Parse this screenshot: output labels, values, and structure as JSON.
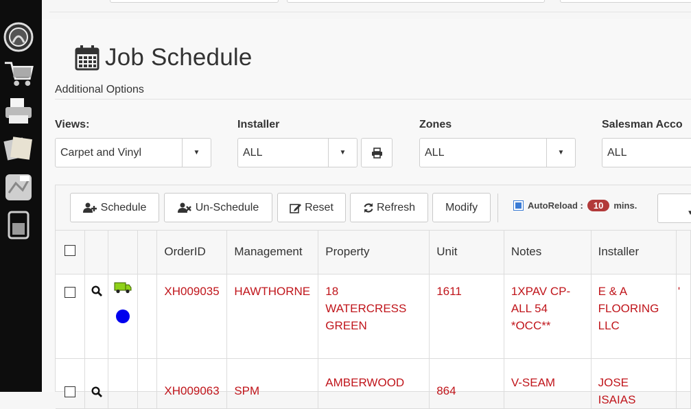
{
  "dock": {
    "items": [
      {
        "name": "dashboard-icon"
      },
      {
        "name": "cart-icon"
      },
      {
        "name": "printer-icon"
      },
      {
        "name": "notes-icon"
      },
      {
        "name": "map-icon"
      },
      {
        "name": "battery-icon"
      }
    ]
  },
  "page": {
    "title": "Job Schedule",
    "additional_options": "Additional Options"
  },
  "filters": {
    "views_label": "Views:",
    "views_value": "Carpet and Vinyl",
    "installer_label": "Installer",
    "installer_value": "ALL",
    "zones_label": "Zones",
    "zones_value": "ALL",
    "salesman_label": "Salesman Acco",
    "salesman_value": "ALL"
  },
  "toolbar": {
    "schedule": "Schedule",
    "unschedule": "Un-Schedule",
    "reset": "Reset",
    "refresh": "Refresh",
    "modify": "Modify",
    "autoreload_label": "AutoReload :",
    "autoreload_value": "10",
    "autoreload_unit": "mins."
  },
  "table": {
    "columns": [
      "",
      "",
      "",
      "",
      "OrderID",
      "Management",
      "Property",
      "Unit",
      "Notes",
      "Installer",
      ""
    ],
    "rows": [
      {
        "order_id": "XH009035",
        "management": "HAWTHORNE",
        "property": "18 WATERCRESS GREEN",
        "unit": "1611",
        "notes": "1XPAV CP-ALL 54 *OCC**",
        "installer": "E & A FLOORING LLC",
        "extra": "'"
      },
      {
        "order_id": "XH009063",
        "management": "SPM",
        "property": "AMBERWOOD",
        "unit": "864",
        "notes": "V-SEAM",
        "installer": "JOSE ISAIAS",
        "extra": ""
      }
    ]
  },
  "colors": {
    "accent_red": "#c0151b",
    "badge_red": "#b23a3a",
    "checkbox_blue": "#3a7bd5",
    "truck_green": "#8fd11a",
    "dot_blue": "#0000ee"
  }
}
